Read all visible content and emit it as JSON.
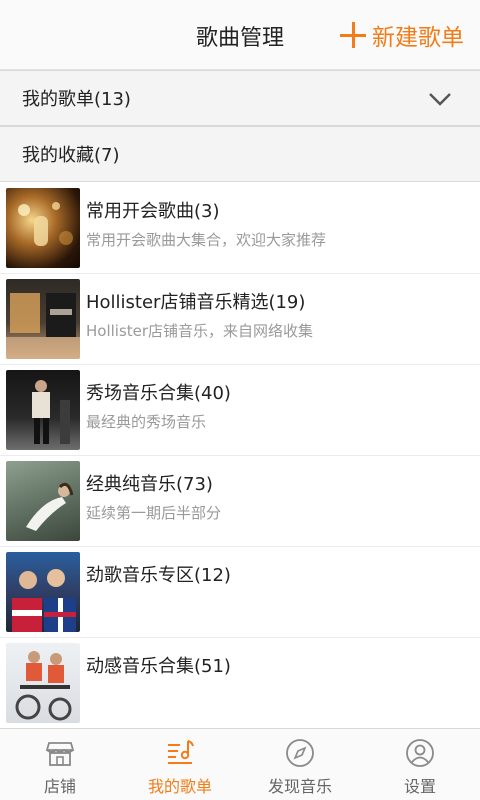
{
  "header": {
    "title": "歌曲管理",
    "new_playlist_label": "新建歌单",
    "accent_color": "#f07d1a"
  },
  "sections": {
    "my_playlists": "我的歌单(13)",
    "my_favorites": "我的收藏(7)"
  },
  "playlists": [
    {
      "name": "常用开会歌曲(3)",
      "desc": "常用开会歌曲大集合，欢迎大家推荐"
    },
    {
      "name": "Hollister店铺音乐精选(19)",
      "desc": "Hollister店铺音乐，来自网络收集"
    },
    {
      "name": "秀场音乐合集(40)",
      "desc": "最经典的秀场音乐"
    },
    {
      "name": "经典纯音乐(73)",
      "desc": "延续第一期后半部分"
    },
    {
      "name": "劲歌音乐专区(12)",
      "desc": ""
    },
    {
      "name": "动感音乐合集(51)",
      "desc": ""
    }
  ],
  "tabs": [
    {
      "label": "店铺",
      "icon": "store-icon"
    },
    {
      "label": "我的歌单",
      "icon": "music-list-icon",
      "active": true
    },
    {
      "label": "发现音乐",
      "icon": "compass-icon"
    },
    {
      "label": "设置",
      "icon": "user-settings-icon"
    }
  ]
}
